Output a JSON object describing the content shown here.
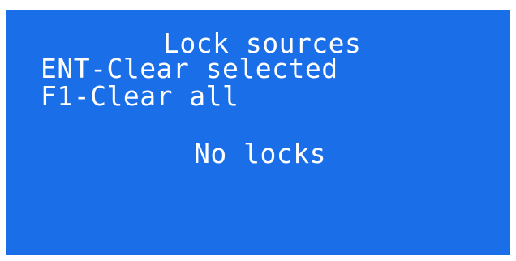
{
  "screen": {
    "title": "Lock sources",
    "help_lines": [
      "ENT-Clear selected",
      "F1-Clear all"
    ],
    "empty_message": "No locks"
  },
  "colors": {
    "background": "#1a6fe8",
    "text": "#ffffff",
    "border": "#ffffff"
  }
}
